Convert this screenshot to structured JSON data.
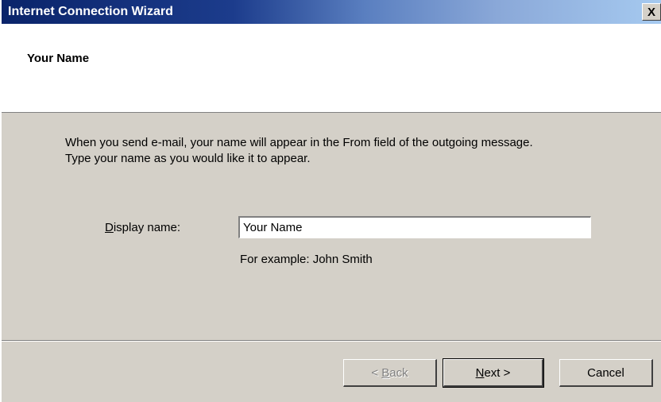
{
  "window": {
    "title": "Internet Connection Wizard",
    "close_glyph": "X"
  },
  "header": {
    "title": "Your Name"
  },
  "body": {
    "instruction_line1": "When you send e-mail, your name will appear in the From field of the outgoing message.",
    "instruction_line2": "Type your name as you would like it to appear.",
    "display_name_label_accel": "D",
    "display_name_label_rest": "isplay name:",
    "display_name_value": "Your Name",
    "example_text": "For example: John Smith"
  },
  "buttons": {
    "back_prefix": "< ",
    "back_accel": "B",
    "back_rest": "ack",
    "next_accel": "N",
    "next_rest": "ext >",
    "cancel": "Cancel"
  },
  "icons": {
    "close": "close-icon"
  },
  "colors": {
    "titlebar_start": "#0a246a",
    "titlebar_end": "#a6caf0",
    "dialog_face": "#d4d0c8",
    "header_bg": "#ffffff",
    "disabled_text": "#808080"
  }
}
